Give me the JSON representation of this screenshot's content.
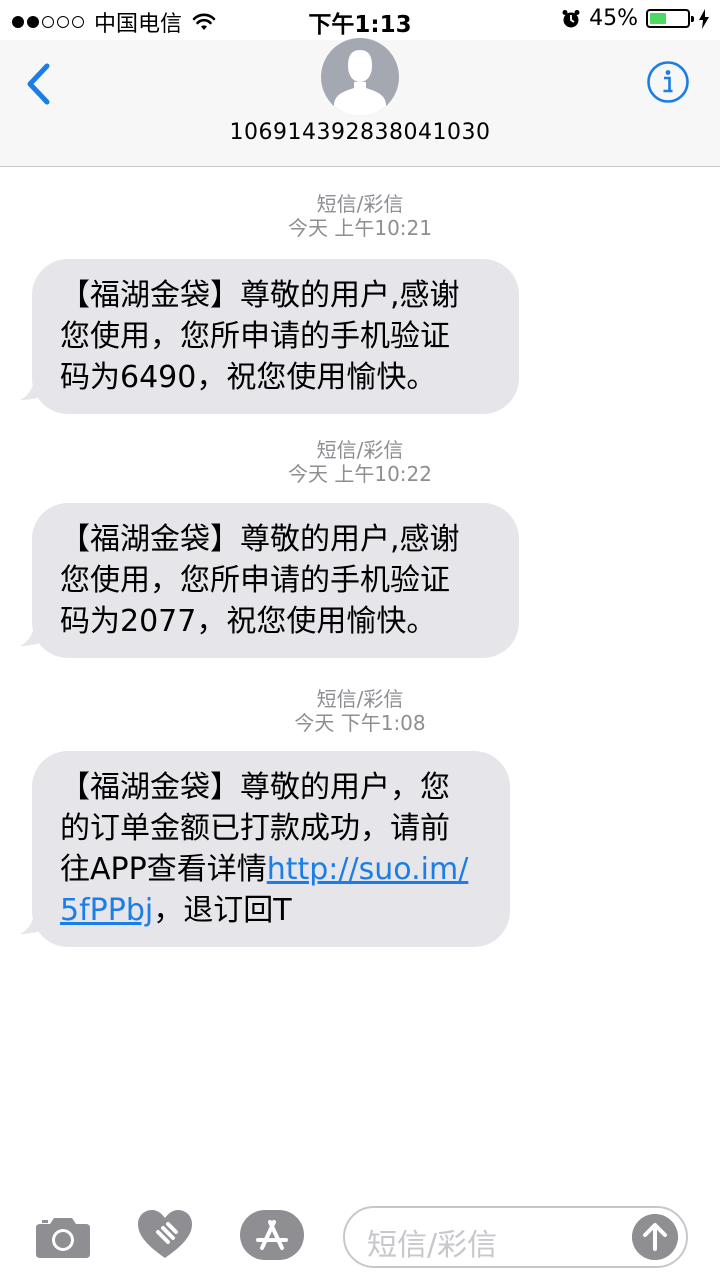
{
  "status_bar": {
    "carrier": "中国电信",
    "time": "下午1:13",
    "battery_text": "45%",
    "battery_level": 0.45,
    "signal_bars": 2
  },
  "header": {
    "contact_number": "106914392838041030",
    "back_icon": "chevron-left-icon",
    "info_icon": "info-icon"
  },
  "messages": [
    {
      "type_label": "短信/彩信",
      "timestamp": "今天 上午10:21",
      "lines": [
        "【福湖金袋】尊敬的用户,感谢",
        "您使用，您所申请的手机验证",
        "码为6490，祝您使用愉快。"
      ]
    },
    {
      "type_label": "短信/彩信",
      "timestamp": "今天 上午10:22",
      "lines": [
        "【福湖金袋】尊敬的用户,感谢",
        "您使用，您所申请的手机验证",
        "码为2077，祝您使用愉快。"
      ]
    },
    {
      "type_label": "短信/彩信",
      "timestamp": "今天 下午1:08",
      "line1": "【福湖金袋】尊敬的用户，您",
      "line2": "的订单金额已打款成功，请前",
      "line3_text": "往APP查看详情",
      "line3_link": "http://suo.im/",
      "line4_link": "5fPPbj",
      "line4_text": "，退订回T"
    }
  ],
  "input_bar": {
    "placeholder": "短信/彩信",
    "camera_icon": "camera-icon",
    "digital_touch_icon": "heart-hand-icon",
    "app_store_icon": "app-store-icon",
    "send_icon": "arrow-up-icon"
  },
  "colors": {
    "accent": "#1a7ee6",
    "bubble": "#e5e5ea",
    "timestamp": "#8e8e93",
    "battery": "#4cd964"
  }
}
